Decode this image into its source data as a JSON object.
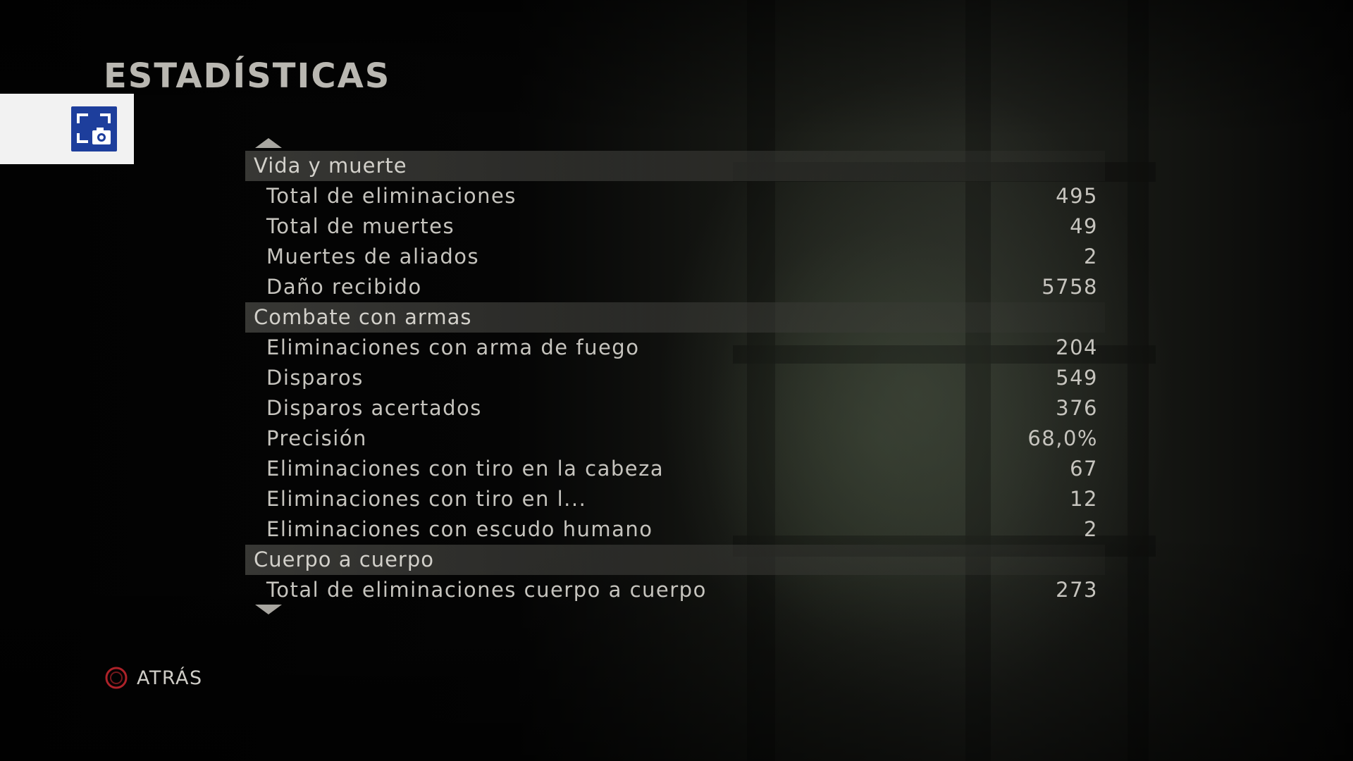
{
  "page": {
    "title": "ESTADÍSTICAS"
  },
  "capture_overlay": {
    "icon": "screenshot-camera-icon",
    "background": "#f2f2f2",
    "icon_color": "#1d3e9c"
  },
  "stats": {
    "sections": [
      {
        "header": "Vida y muerte",
        "rows": [
          {
            "label": "Total de eliminaciones",
            "value": "495"
          },
          {
            "label": "Total de muertes",
            "value": "49"
          },
          {
            "label": "Muertes de aliados",
            "value": "2"
          },
          {
            "label": "Daño recibido",
            "value": "5758"
          }
        ]
      },
      {
        "header": "Combate con armas",
        "rows": [
          {
            "label": "Eliminaciones con arma de fuego",
            "value": "204"
          },
          {
            "label": "Disparos",
            "value": "549"
          },
          {
            "label": "Disparos acertados",
            "value": "376"
          },
          {
            "label": "Precisión",
            "value": "68,0%"
          },
          {
            "label": "Eliminaciones con tiro en la cabeza",
            "value": "67"
          },
          {
            "label": "Eliminaciones con tiro en l...",
            "value": "12"
          },
          {
            "label": "Eliminaciones con escudo humano",
            "value": "2"
          }
        ]
      },
      {
        "header": "Cuerpo a cuerpo",
        "rows": [
          {
            "label": "Total de eliminaciones cuerpo a cuerpo",
            "value": "273"
          }
        ]
      }
    ],
    "scroll_up_icon": "triangle-up-icon",
    "scroll_down_icon": "triangle-down-icon"
  },
  "footer": {
    "back_button_icon": "circle-button-icon",
    "back_label": "ATRÁS",
    "accent_color": "#c0262d"
  }
}
